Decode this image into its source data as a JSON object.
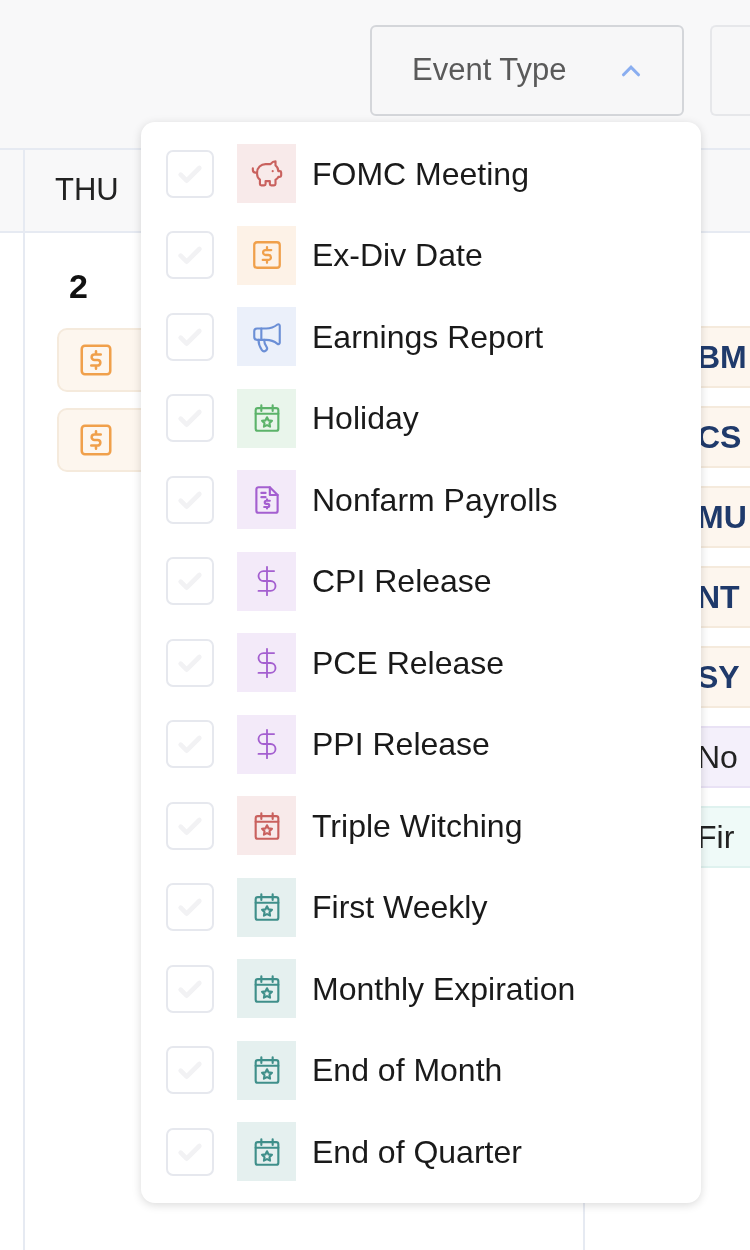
{
  "toolbar": {
    "event_type_button": {
      "label": "Event Type",
      "expanded": true
    }
  },
  "calendar": {
    "day_header": "THU",
    "day_number": "2",
    "left_events": [
      {
        "kind": "exdiv"
      },
      {
        "kind": "exdiv"
      }
    ],
    "right_events": [
      {
        "kind": "exdiv",
        "label": "BM"
      },
      {
        "kind": "exdiv",
        "label": "CS"
      },
      {
        "kind": "exdiv",
        "label": "MU"
      },
      {
        "kind": "exdiv",
        "label": "NT"
      },
      {
        "kind": "exdiv",
        "label": "SY"
      },
      {
        "kind": "payrolls",
        "label": "No"
      },
      {
        "kind": "weekly",
        "label": "Fir"
      }
    ]
  },
  "event_type_menu": [
    {
      "label": "FOMC Meeting",
      "checked": false,
      "kind": "piggy",
      "color": "#c9615e"
    },
    {
      "label": "Ex-Div Date",
      "checked": false,
      "kind": "dollar-square",
      "color": "#f0a04b"
    },
    {
      "label": "Earnings Report",
      "checked": false,
      "kind": "megaphone",
      "color": "#6b8fd6"
    },
    {
      "label": "Holiday",
      "checked": false,
      "kind": "calendar",
      "color": "#5cb36a"
    },
    {
      "label": "Nonfarm Payrolls",
      "checked": false,
      "kind": "document",
      "color": "#a45fd0"
    },
    {
      "label": "CPI Release",
      "checked": false,
      "kind": "dollar",
      "color": "#a45fd0"
    },
    {
      "label": "PCE Release",
      "checked": false,
      "kind": "dollar",
      "color": "#a45fd0"
    },
    {
      "label": "PPI Release",
      "checked": false,
      "kind": "dollar",
      "color": "#a45fd0"
    },
    {
      "label": "Triple Witching",
      "checked": false,
      "kind": "calendar",
      "color": "#c9615e"
    },
    {
      "label": "First Weekly",
      "checked": false,
      "kind": "calendar",
      "color": "#3f8f8a"
    },
    {
      "label": "Monthly Expiration",
      "checked": false,
      "kind": "calendar",
      "color": "#3f8f8a"
    },
    {
      "label": "End of Month",
      "checked": false,
      "kind": "calendar",
      "color": "#3f8f8a"
    },
    {
      "label": "End of Quarter",
      "checked": false,
      "kind": "calendar",
      "color": "#3f8f8a"
    }
  ]
}
